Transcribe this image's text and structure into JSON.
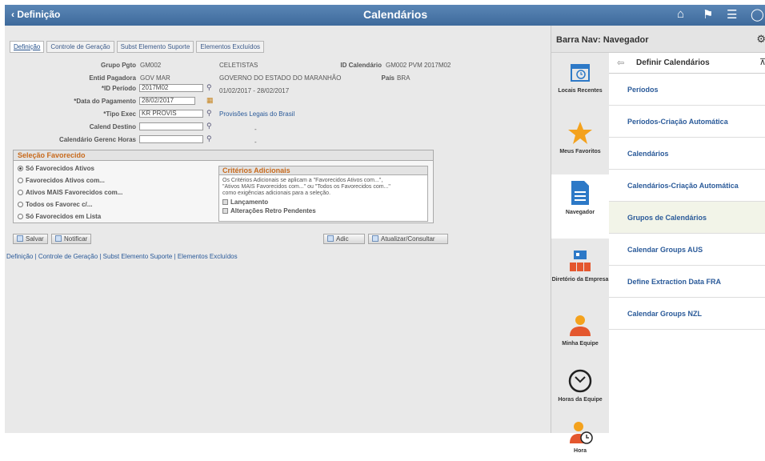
{
  "topbar": {
    "back_label": "Definição",
    "title": "Calendários"
  },
  "tabs": [
    "Definição",
    "Controle de Geração",
    "Subst Elemento Suporte",
    "Elementos Excluídos"
  ],
  "form": {
    "grupo_pgto_label": "Grupo Pgto",
    "grupo_pgto_value": "GM002",
    "grupo_pgto_desc": "CELETISTAS",
    "id_calendario_label": "ID Calendário",
    "id_calendario_value": "GM002 PVM 2017M02",
    "entid_label": "Entid Pagadora",
    "entid_value": "GOV MAR",
    "entid_desc": "GOVERNO DO ESTADO DO MARANHÃO",
    "pais_label": "País",
    "pais_value": "BRA",
    "id_periodo_label": "*ID Período",
    "id_periodo_value": "2017M02",
    "periodo_range": "01/02/2017  -  28/02/2017",
    "data_pgto_label": "*Data do Pagamento",
    "data_pgto_value": "28/02/2017",
    "tipo_exec_label": "*Tipo Exec",
    "tipo_exec_value": "KR PROVIS",
    "tipo_exec_desc": "Provisões Legais do Brasil",
    "calend_destino_label": "Calend Destino",
    "calend_destino_value": "",
    "calend_destino_desc": "-",
    "cal_gerenc_label": "Calendário Gerenc Horas",
    "cal_gerenc_value": "",
    "cal_gerenc_desc": "-"
  },
  "favorecido": {
    "title": "Seleção Favorecido",
    "options": [
      "Só Favorecidos Ativos",
      "Favorecidos Ativos com...",
      "Ativos MAIS Favorecidos com...",
      "Todos os Favorec c/...",
      "Só Favorecidos em Lista"
    ],
    "selected_index": 0,
    "criterios_title": "Critérios Adicionais",
    "criterios_text_1": "Os Critérios Adicionais se aplicam a \"Favorecidos Ativos com...\",",
    "criterios_text_2": "\"Ativos MAIS Favorecidos com...\" ou \"Todos os Favorecidos com...\"",
    "criterios_text_3": "como exigências adicionais para a seleção.",
    "chk_lancamento": "Lançamento",
    "chk_retro": "Alterações Retro Pendentes"
  },
  "buttons": {
    "salvar": "Salvar",
    "notificar": "Notificar",
    "adic": "Adic",
    "atualizar": "Atualizar/Consultar"
  },
  "footer_links": "Definição | Controle de Geração | Subst Elemento Suporte | Elementos Excluídos",
  "panel": {
    "title": "Barra Nav: Navegador",
    "nav": [
      "Locais Recentes",
      "Meus Favoritos",
      "Navegador",
      "Diretório da Empresa",
      "Minha Equipe",
      "Horas da Equipe",
      "Hora"
    ],
    "list_title": "Definir Calendários",
    "items": [
      "Períodos",
      "Períodos-Criação Automática",
      "Calendários",
      "Calendários-Criação Automática",
      "Grupos de Calendários",
      "Calendar Groups AUS",
      "Define Extraction Data FRA",
      "Calendar Groups NZL"
    ]
  },
  "colors": {
    "accent": "#3e6a9c",
    "link": "#2a5a99",
    "section_title": "#c86a1c",
    "star": "#f4a21d",
    "nav_selected": "#2d79c7"
  }
}
